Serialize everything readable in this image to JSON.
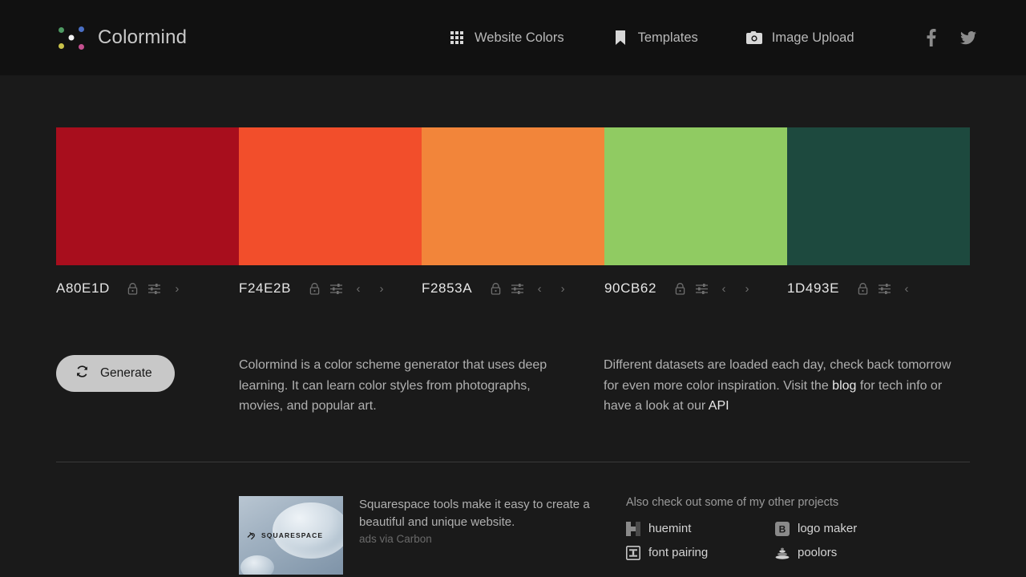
{
  "header": {
    "brand": "Colormind",
    "logo_icon": "colormind-dots-logo",
    "nav": [
      {
        "label": "Website Colors",
        "icon": "grid-icon"
      },
      {
        "label": "Templates",
        "icon": "bookmark-icon"
      },
      {
        "label": "Image Upload",
        "icon": "camera-icon"
      }
    ],
    "social": [
      {
        "name": "facebook-icon",
        "glyph": "f"
      },
      {
        "name": "twitter-icon",
        "glyph": "bird"
      }
    ]
  },
  "palette": {
    "swatches": [
      {
        "hex": "A80E1D",
        "color": "#A80E1D",
        "lock": "unlocked",
        "has_prev": false,
        "has_next": true
      },
      {
        "hex": "F24E2B",
        "color": "#F24E2B",
        "lock": "unlocked",
        "has_prev": true,
        "has_next": true
      },
      {
        "hex": "F2853A",
        "color": "#F2853A",
        "lock": "unlocked",
        "has_prev": true,
        "has_next": true
      },
      {
        "hex": "90CB62",
        "color": "#90CB62",
        "lock": "unlocked",
        "has_prev": true,
        "has_next": true
      },
      {
        "hex": "1D493E",
        "color": "#1D493E",
        "lock": "unlocked",
        "has_prev": true,
        "has_next": false
      }
    ],
    "controls": {
      "lock_icon": "lock-icon",
      "adjust_icon": "sliders-icon",
      "prev_icon": "chevron-left-icon",
      "next_icon": "chevron-right-icon"
    }
  },
  "main": {
    "generate_label": "Generate",
    "generate_icon": "refresh-icon",
    "description": "Colormind is a color scheme generator that uses deep learning. It can learn color styles from photographs, movies, and popular art.",
    "datasets_part1": "Different datasets are loaded each day, check back tomorrow for even more color inspiration. Visit the ",
    "blog_link": "blog",
    "datasets_part2": " for tech info or have a look at our ",
    "api_link": "API"
  },
  "footer": {
    "ad": {
      "image_logo": "SQUARESPACE",
      "text": "Squarespace tools make it easy to create a beautiful and unique website.",
      "via": "ads via Carbon"
    },
    "projects_title": "Also check out some of my other projects",
    "projects": [
      {
        "label": "huemint",
        "icon": "huemint-icon"
      },
      {
        "label": "logo maker",
        "icon": "logo-maker-icon"
      },
      {
        "label": "font pairing",
        "icon": "font-pairing-icon"
      },
      {
        "label": "poolors",
        "icon": "poolors-icon"
      }
    ]
  },
  "colors": {
    "page_bg": "#1a1a1a",
    "header_bg": "#111111",
    "text_primary": "#e6e6e6",
    "text_muted": "#b0b0b0",
    "divider": "#3a3a3a"
  }
}
